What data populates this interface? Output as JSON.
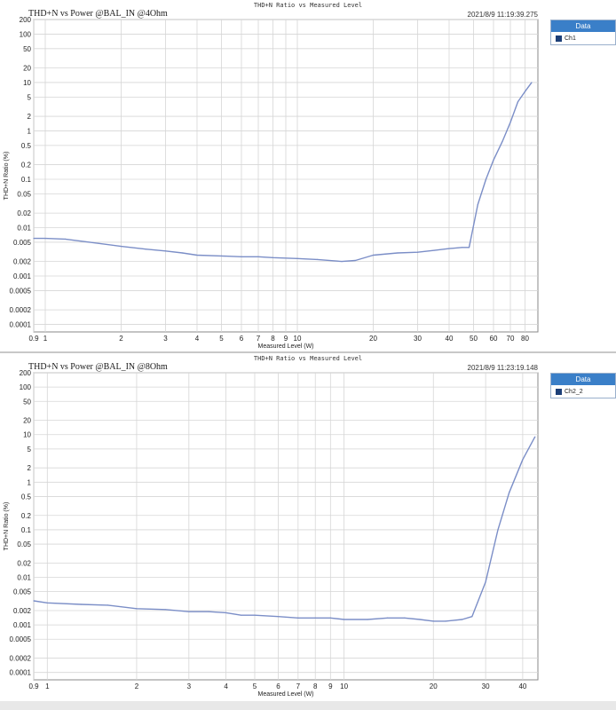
{
  "chart_data": [
    {
      "type": "line",
      "title": "THD+N vs Power @BAL_IN @4Ohm",
      "subtitle": "THD+N Ratio vs Measured Level",
      "timestamp": "2021/8/9 11:19:39.275",
      "xlabel": "Measured Level (W)",
      "ylabel": "THD+N Ratio (%)",
      "xscale": "log",
      "yscale": "log",
      "xlim": [
        0.9,
        90
      ],
      "ylim": [
        7e-05,
        200
      ],
      "xticks": [
        "0.9",
        "1",
        "2",
        "3",
        "4",
        "5",
        "6",
        "7",
        "8",
        "9",
        "10",
        "20",
        "30",
        "40",
        "50",
        "60",
        "70",
        "80"
      ],
      "yticks": [
        "200",
        "100",
        "50",
        "20",
        "10",
        "5",
        "2",
        "1",
        "0.5",
        "0.2",
        "0.1",
        "0.05",
        "0.02",
        "0.01",
        "0.005",
        "0.002",
        "0.001",
        "0.0005",
        "0.0002",
        "0.0001"
      ],
      "grid": true,
      "legend_title": "Data",
      "series": [
        {
          "name": "Ch1",
          "color": "#7b8ec7",
          "x": [
            0.9,
            1.0,
            1.2,
            1.5,
            2.0,
            2.5,
            3.0,
            3.5,
            4.0,
            5.0,
            6.0,
            7.0,
            8.0,
            10.0,
            12.0,
            15.0,
            17.0,
            20.0,
            25.0,
            30.0,
            35.0,
            40.0,
            45.0,
            48.0,
            52.0,
            56.0,
            60.0,
            65.0,
            70.0,
            75.0,
            80.0,
            85.0
          ],
          "y": [
            0.006,
            0.006,
            0.0058,
            0.005,
            0.0041,
            0.0036,
            0.0033,
            0.003,
            0.0027,
            0.0026,
            0.0025,
            0.0025,
            0.0024,
            0.0023,
            0.0022,
            0.002,
            0.0021,
            0.0027,
            0.003,
            0.0031,
            0.0034,
            0.0037,
            0.0039,
            0.0039,
            0.03,
            0.1,
            0.25,
            0.6,
            1.5,
            4,
            6.5,
            10
          ]
        }
      ]
    },
    {
      "type": "line",
      "title": "THD+N vs Power @BAL_IN @8Ohm",
      "subtitle": "THD+N Ratio vs Measured Level",
      "timestamp": "2021/8/9 11:23:19.148",
      "xlabel": "Measured Level (W)",
      "ylabel": "THD+N Ratio (%)",
      "xscale": "log",
      "yscale": "log",
      "xlim": [
        0.9,
        45
      ],
      "ylim": [
        7e-05,
        200
      ],
      "xticks": [
        "0.9",
        "1",
        "2",
        "3",
        "4",
        "5",
        "6",
        "7",
        "8",
        "9",
        "10",
        "20",
        "30",
        "40"
      ],
      "yticks": [
        "200",
        "100",
        "50",
        "20",
        "10",
        "5",
        "2",
        "1",
        "0.5",
        "0.2",
        "0.1",
        "0.05",
        "0.02",
        "0.01",
        "0.005",
        "0.002",
        "0.001",
        "0.0005",
        "0.0002",
        "0.0001"
      ],
      "grid": true,
      "legend_title": "Data",
      "series": [
        {
          "name": "Ch2_2",
          "color": "#7b8ec7",
          "x": [
            0.9,
            1.0,
            1.3,
            1.6,
            2.0,
            2.5,
            3.0,
            3.5,
            4.0,
            4.5,
            5.0,
            6.0,
            7.0,
            8.0,
            9.0,
            10.0,
            12.0,
            14.0,
            16.0,
            18.0,
            20.0,
            22.0,
            25.0,
            27.0,
            30.0,
            33.0,
            36.0,
            40.0,
            44.0
          ],
          "y": [
            0.0032,
            0.0029,
            0.0027,
            0.0026,
            0.0022,
            0.0021,
            0.0019,
            0.0019,
            0.0018,
            0.0016,
            0.0016,
            0.0015,
            0.0014,
            0.0014,
            0.0014,
            0.0013,
            0.0013,
            0.0014,
            0.0014,
            0.0013,
            0.0012,
            0.0012,
            0.0013,
            0.0015,
            0.008,
            0.1,
            0.6,
            3,
            9
          ]
        }
      ]
    }
  ]
}
